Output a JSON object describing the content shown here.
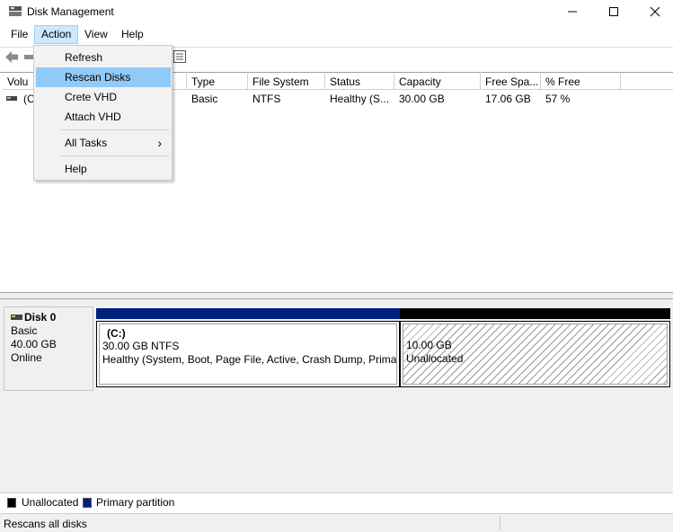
{
  "window": {
    "title": "Disk Management"
  },
  "menu": [
    "File",
    "Action",
    "View",
    "Help"
  ],
  "dropdown": {
    "items": [
      "Refresh",
      "Rescan Disks",
      "Crete VHD",
      "Attach VHD"
    ],
    "all_tasks": "All Tasks",
    "help": "Help",
    "submenu_arrow": "›"
  },
  "volume_list": {
    "headers": [
      "Volu",
      "Type",
      "File System",
      "Status",
      "Capacity",
      "Free Spa...",
      "% Free"
    ],
    "row": {
      "volume": "(C",
      "type": "Basic",
      "fs": "NTFS",
      "status": "Healthy (S...",
      "capacity": "30.00 GB",
      "free": "17.06 GB",
      "pct": "57 %"
    }
  },
  "disk": {
    "name": "Disk 0",
    "type": "Basic",
    "size": "40.00 GB",
    "state": "Online",
    "partitions": [
      {
        "label": "(C:)",
        "size": "30.00 GB NTFS",
        "status": "Healthy (System, Boot, Page File, Active, Crash Dump, Primar"
      },
      {
        "size": "10.00 GB",
        "status": "Unallocated"
      }
    ]
  },
  "legend": [
    "Unallocated",
    "Primary partition"
  ],
  "colors": {
    "primary": "#00207f",
    "unallocated": "#000000",
    "highlight": "#91c9f7"
  },
  "statusbar": {
    "text": "Rescans all disks"
  }
}
